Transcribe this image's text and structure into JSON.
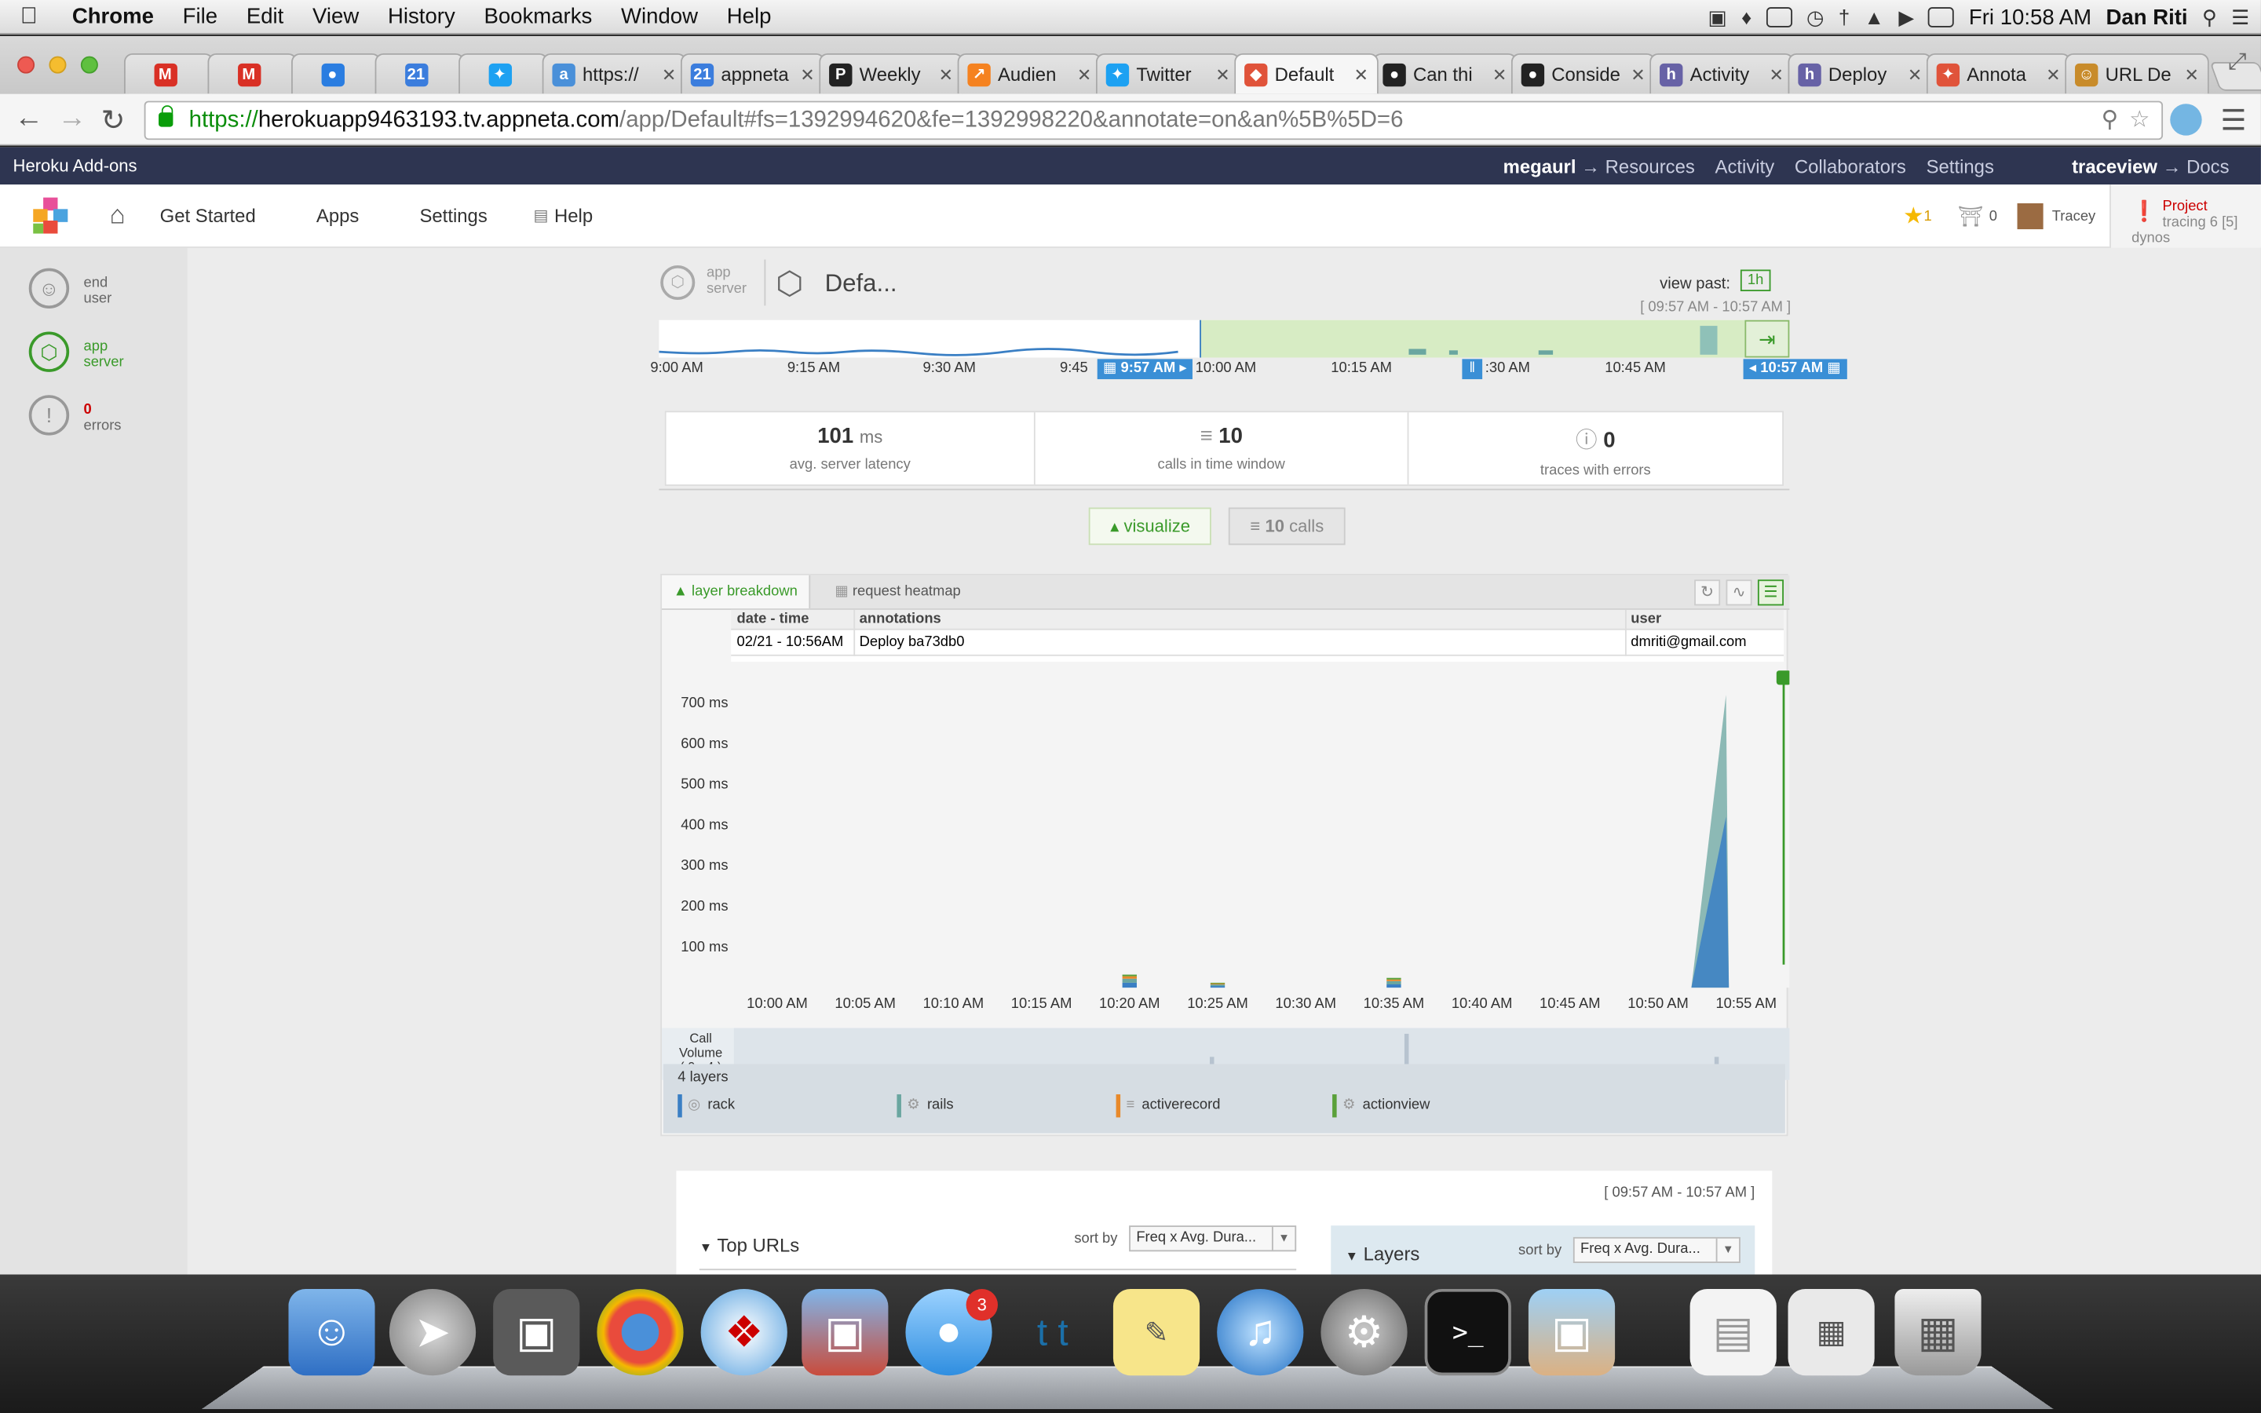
{
  "menubar": {
    "app": "Chrome",
    "items": [
      "File",
      "Edit",
      "View",
      "History",
      "Bookmarks",
      "Window",
      "Help"
    ],
    "clock": "Fri 10:58 AM",
    "user": "Dan Riti"
  },
  "tabs": [
    {
      "label": "",
      "fav": "M",
      "color": "#d93025"
    },
    {
      "label": "",
      "fav": "M",
      "color": "#d93025"
    },
    {
      "label": "",
      "fav": "●",
      "color": "#2a7de1"
    },
    {
      "label": "",
      "fav": "21",
      "color": "#3b7ddd"
    },
    {
      "label": "",
      "fav": "✦",
      "color": "#1da1f2"
    },
    {
      "label": "https://",
      "fav": "a",
      "color": "#4a90d9"
    },
    {
      "label": "appneta",
      "fav": "21",
      "color": "#3b7ddd"
    },
    {
      "label": "Weekly",
      "fav": "P",
      "color": "#222"
    },
    {
      "label": "Audien",
      "fav": "↗",
      "color": "#f58220"
    },
    {
      "label": "Twitter",
      "fav": "✦",
      "color": "#1da1f2"
    },
    {
      "label": "Default",
      "fav": "◆",
      "color": "#e0533a",
      "active": true
    },
    {
      "label": "Can thi",
      "fav": "●",
      "color": "#222"
    },
    {
      "label": "Conside",
      "fav": "●",
      "color": "#222"
    },
    {
      "label": "Activity",
      "fav": "h",
      "color": "#6762a6"
    },
    {
      "label": "Deploy",
      "fav": "h",
      "color": "#6762a6"
    },
    {
      "label": "Annota",
      "fav": "✦",
      "color": "#e0533a"
    },
    {
      "label": "URL De",
      "fav": "☺",
      "color": "#c88b2a"
    }
  ],
  "omnibox": {
    "scheme": "https://",
    "host": "herokuapp9463193.tv.appneta.com",
    "path": "/app/Default#fs=1392994620&fe=1392998220&annotate=on&an%5B%5D=6"
  },
  "heroku": {
    "title": "Heroku Add-ons",
    "app": "megaurl",
    "arrow": "→",
    "links": [
      "Resources",
      "Activity",
      "Collaborators",
      "Settings"
    ],
    "addon": "traceview",
    "docs": "Docs"
  },
  "appnav": {
    "items": [
      "Get Started",
      "Apps",
      "Settings",
      "Help"
    ],
    "stars": "1",
    "alerts": "0",
    "user": "Tracey",
    "project_label": "Project",
    "project_sub": "tracing 6 [5] dynos"
  },
  "rail": {
    "end_user": [
      "end",
      "user"
    ],
    "app_server": [
      "app",
      "server"
    ],
    "errors_count": "0",
    "errors_label": "errors"
  },
  "header": {
    "layer_label": [
      "app",
      "server"
    ],
    "app_name": "Defa...",
    "view_past_label": "view past:",
    "view_past_value": "1h",
    "range": "[ 09:57 AM - 10:57 AM ]"
  },
  "timeline": {
    "ticks": [
      "9:00 AM",
      "9:15 AM",
      "9:30 AM",
      "9:45",
      "10:00 AM",
      "10:15 AM",
      ":30 AM",
      "10:45 AM"
    ],
    "start_handle": "9:57 AM",
    "end_handle": "10:57 AM"
  },
  "stats": [
    {
      "value": "101",
      "unit": "ms",
      "label": "avg. server latency"
    },
    {
      "value": "10",
      "unit": "",
      "label": "calls in time window"
    },
    {
      "value": "0",
      "unit": "",
      "label": "traces with errors"
    }
  ],
  "view_tabs": {
    "visualize": "visualize",
    "calls_count": "10",
    "calls_label": "calls"
  },
  "chart_tabs": {
    "breakdown": "layer breakdown",
    "heatmap": "request heatmap"
  },
  "annotations": {
    "headers": [
      "date - time",
      "annotations",
      "user"
    ],
    "rows": [
      [
        "02/21 - 10:56AM",
        "Deploy ba73db0",
        "dmriti@gmail.com"
      ]
    ]
  },
  "chart_data": {
    "type": "area",
    "ylabel": "",
    "yticks": [
      "700 ms",
      "600 ms",
      "500 ms",
      "400 ms",
      "300 ms",
      "200 ms",
      "100 ms"
    ],
    "ylim": [
      0,
      780
    ],
    "categories": [
      "10:00 AM",
      "10:05 AM",
      "10:10 AM",
      "10:15 AM",
      "10:20 AM",
      "10:25 AM",
      "10:30 AM",
      "10:35 AM",
      "10:40 AM",
      "10:45 AM",
      "10:50 AM",
      "10:55 AM"
    ],
    "series": [
      {
        "name": "rack",
        "color": "#3a7fc4",
        "values": [
          0,
          0,
          0,
          0,
          12,
          4,
          0,
          8,
          0,
          0,
          0,
          420
        ]
      },
      {
        "name": "rails",
        "color": "#6aa6a0",
        "values": [
          0,
          0,
          0,
          0,
          10,
          4,
          0,
          8,
          0,
          0,
          0,
          300
        ]
      },
      {
        "name": "activerecord",
        "color": "#e8892a",
        "values": [
          0,
          0,
          0,
          0,
          6,
          2,
          0,
          4,
          0,
          0,
          0,
          20
        ]
      },
      {
        "name": "actionview",
        "color": "#5aa03a",
        "values": [
          0,
          0,
          0,
          0,
          4,
          2,
          0,
          4,
          0,
          0,
          0,
          30
        ]
      }
    ],
    "annotation_at": "10:56 AM"
  },
  "call_volume": {
    "label": [
      "Call",
      "Volume",
      "( 0 - 4 )"
    ]
  },
  "layers": {
    "count_label": "4 layers",
    "items": [
      {
        "name": "rack",
        "color": "#3a7fc4"
      },
      {
        "name": "rails",
        "color": "#6aa6a0"
      },
      {
        "name": "activerecord",
        "color": "#e8892a"
      },
      {
        "name": "actionview",
        "color": "#5aa03a"
      }
    ]
  },
  "bottom": {
    "range": "[ 09:57 AM - 10:57 AM ]",
    "top_urls": "Top URLs",
    "sort_by": "sort by",
    "sort_value": "Freq x Avg. Dura...",
    "layers_title": "Layers",
    "sort_value2": "Freq x Avg. Dura..."
  }
}
